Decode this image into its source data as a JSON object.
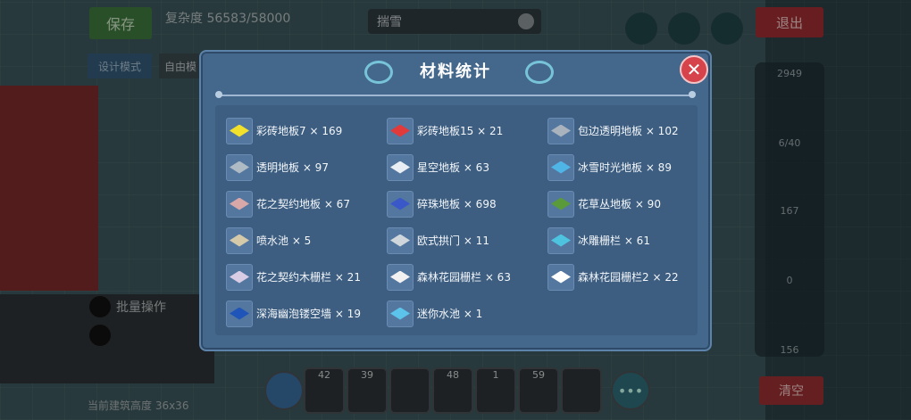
{
  "hud": {
    "save_label": "保存",
    "progress_label": "复杂度 56583/58000",
    "search_text": "揣雪",
    "exit_label": "退出",
    "design_mode_label": "设计模式",
    "free_mode_label": "自由模",
    "batch_label": "批量操作",
    "bottom_text": "当前建筑高度 36x36",
    "clear_label": "清空",
    "side_numbers": [
      "2949",
      "6/40",
      "167",
      "0",
      "156"
    ],
    "hotbar_counts": [
      "42",
      "39",
      "",
      "48",
      "1",
      "59",
      ""
    ],
    "more_label": "•••"
  },
  "dialog": {
    "title": "材料统计",
    "close_label": "✕",
    "items": [
      {
        "label": "彩砖地板7 × 169",
        "icon": "yellow-tile-icon",
        "color": "#f2e12a"
      },
      {
        "label": "彩砖地板15 × 21",
        "icon": "red-tile-icon",
        "color": "#e03a3a"
      },
      {
        "label": "包边透明地板 × 102",
        "icon": "edged-clear-tile-icon",
        "color": "#a8b3bd"
      },
      {
        "label": "透明地板 × 97",
        "icon": "clear-tile-icon",
        "color": "#aebac4"
      },
      {
        "label": "星空地板 × 63",
        "icon": "starry-tile-icon",
        "color": "#e8eef3"
      },
      {
        "label": "冰雪时光地板 × 89",
        "icon": "ice-tile-icon",
        "color": "#4fb4e6"
      },
      {
        "label": "花之契约地板 × 67",
        "icon": "flower-tile-icon",
        "color": "#d8a7a7"
      },
      {
        "label": "碎珠地板 × 698",
        "icon": "bead-tile-icon",
        "color": "#3a58c8"
      },
      {
        "label": "花草丛地板 × 90",
        "icon": "grass-tile-icon",
        "color": "#5b9a3a"
      },
      {
        "label": "喷水池 × 5",
        "icon": "fountain-icon",
        "color": "#d4c9a8"
      },
      {
        "label": "欧式拱门 × 11",
        "icon": "arch-door-icon",
        "color": "#cfd6dc"
      },
      {
        "label": "冰雕栅栏 × 61",
        "icon": "ice-fence-icon",
        "color": "#4ec3e0"
      },
      {
        "label": "花之契约木栅栏 × 21",
        "icon": "wood-fence-icon",
        "color": "#d9cde6"
      },
      {
        "label": "森林花园栅栏 × 63",
        "icon": "garden-fence-icon",
        "color": "#f2f2f2"
      },
      {
        "label": "森林花园栅栏2 × 22",
        "icon": "garden-fence-2-icon",
        "color": "#ffffff"
      },
      {
        "label": "深海幽泡镂空墙 × 19",
        "icon": "deep-sea-wall-icon",
        "color": "#1f55b8"
      },
      {
        "label": "迷你水池 × 1",
        "icon": "mini-pool-icon",
        "color": "#5cc4ea"
      }
    ]
  }
}
